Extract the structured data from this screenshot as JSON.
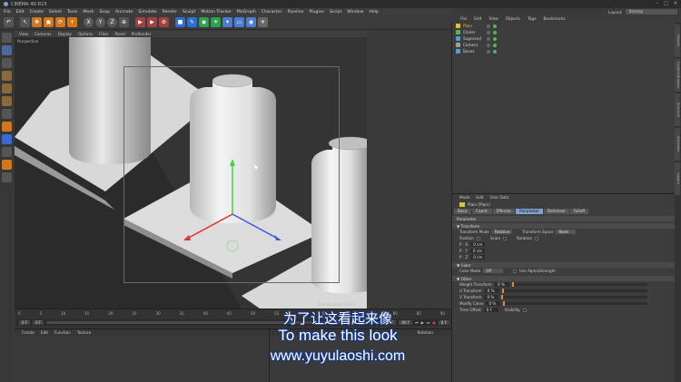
{
  "window": {
    "title": "CINEMA 4D R15"
  },
  "menubar": {
    "items": [
      "File",
      "Edit",
      "Create",
      "Select",
      "Tools",
      "Mesh",
      "Snap",
      "Animate",
      "Simulate",
      "Render",
      "Sculpt",
      "Motion Tracker",
      "MoGraph",
      "Character",
      "Pipeline",
      "Plugins",
      "Script",
      "Window",
      "Help"
    ]
  },
  "layout": {
    "label": "Layout:",
    "value": "Startup"
  },
  "toolbar": {
    "axis_x": "X",
    "axis_y": "Y",
    "axis_z": "Z"
  },
  "viewport": {
    "menu": [
      "View",
      "Cameras",
      "Display",
      "Options",
      "Filter",
      "Panel",
      "ProRender"
    ],
    "label": "Perspective",
    "grid_spacing": "Grid Spacing : 10 cm"
  },
  "object_manager": {
    "menu": [
      "File",
      "Edit",
      "View",
      "Objects",
      "Tags",
      "Bookmarks"
    ],
    "objects": [
      {
        "name": "Plain",
        "color": "#e0c040"
      },
      {
        "name": "Cloner",
        "color": "#55b455"
      },
      {
        "name": "Sugmand",
        "color": "#5a9ad5"
      },
      {
        "name": "Camera",
        "color": "#a0a0a0"
      },
      {
        "name": "Bases",
        "color": "#5a9ad5"
      }
    ]
  },
  "attribute_manager": {
    "menu": [
      "Mode",
      "Edit",
      "User Data"
    ],
    "object_name": "Plain [Plain]",
    "tabs": [
      "Basic",
      "Coord.",
      "Effector",
      "Parameter",
      "Deformer",
      "Falloff"
    ],
    "active_tab": "Parameter",
    "section_parameter": "Parameter",
    "section_transform": "Transform",
    "transform_mode_label": "Transform Mode",
    "transform_mode_value": "Relative",
    "transform_space_label": "Transform Space",
    "transform_space_value": "Node",
    "position_label": "Position",
    "scale_label": "Scale",
    "rotation_label": "Rotation",
    "px_label": "P . X",
    "px": "0 cm",
    "py_label": "P . Y",
    "py": "0 cm",
    "pz_label": "P . Z",
    "pz": "0 cm",
    "section_color": "Color",
    "color_mode_label": "Color Mode",
    "color_mode_value": "Off",
    "use_alpha_label": "Use Alpha/Strength",
    "section_other": "Other",
    "rows": [
      {
        "label": "Weight Transform",
        "value": "0 %"
      },
      {
        "label": "U Transform",
        "value": "0 %"
      },
      {
        "label": "V Transform",
        "value": "0 %"
      },
      {
        "label": "Modify Clone",
        "value": "0 %"
      }
    ],
    "time_offset_label": "Time Offset",
    "time_offset_value": "0 F",
    "visibility_label": "Visibility"
  },
  "timeline": {
    "ticks": [
      "0",
      "5",
      "10",
      "15",
      "20",
      "25",
      "30",
      "35",
      "40",
      "45",
      "50",
      "55",
      "60",
      "65",
      "70",
      "75",
      "80",
      "85",
      "90"
    ],
    "start": "0 F",
    "current": "0 F",
    "end": "90 F",
    "end2": "90 F",
    "frame_readout": "0 F"
  },
  "material_manager": {
    "menu": [
      "Create",
      "Edit",
      "Function",
      "Texture"
    ]
  },
  "coordinates": {
    "label": "Rotation"
  },
  "right_strip": {
    "tabs": [
      "Objects",
      "Content Browser",
      "Structure",
      "Attributes",
      "Layers"
    ]
  },
  "subtitles": {
    "chinese": "为了让这看起来像",
    "english": "To make this look",
    "url": "www.yuyulaoshi.com"
  },
  "colors": {
    "accent": "#7f9fcf",
    "axis_y": "#3fd43f",
    "axis_x": "#e03030",
    "axis_z": "#3a5ae0"
  }
}
